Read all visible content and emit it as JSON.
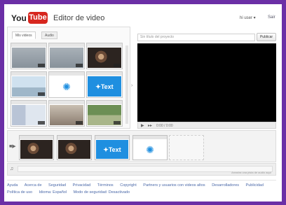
{
  "header": {
    "logo_you": "You",
    "logo_tube": "Tube",
    "title": "Editor de video",
    "user_menu": "hi user ▾",
    "signout": "Sair"
  },
  "library": {
    "tabs": [
      {
        "label": "Mis videos",
        "active": true
      },
      {
        "label": "Audio",
        "active": false
      }
    ],
    "thumbs": [
      {
        "kind": "gray"
      },
      {
        "kind": "gray"
      },
      {
        "kind": "dark"
      },
      {
        "kind": "blue-light"
      },
      {
        "kind": "flower"
      },
      {
        "kind": "text",
        "text": "✦Text"
      },
      {
        "kind": "map"
      },
      {
        "kind": "crowd"
      },
      {
        "kind": "field"
      }
    ]
  },
  "preview": {
    "title_placeholder": "Sin título del proyecto",
    "publish_label": "Publicar",
    "play_icon": "▶",
    "next_icon": "▸▸",
    "time": "0:00 / 0:00"
  },
  "storyboard": {
    "icon": "■▶",
    "clips": [
      {
        "kind": "dark"
      },
      {
        "kind": "dark"
      },
      {
        "kind": "text",
        "text": "✦Text"
      },
      {
        "kind": "flower"
      }
    ]
  },
  "audio": {
    "icon": "♫",
    "hint": "Arrastra una pista de audio aquí"
  },
  "footer": {
    "row1": [
      "Ayuda",
      "Acerca de",
      "Seguridad",
      "Privacidad",
      "Términos",
      "Copyright",
      "Partners y usuarios con videos altos",
      "Desarrolladores",
      "Publicidad"
    ],
    "row2": [
      "Política de uso",
      "Idioma: Español",
      "Modo de seguridad: Desactivado"
    ]
  },
  "colors": {
    "border_purple": "#6b2fa6",
    "youtube_red": "#d7261e",
    "link_blue": "#4a68a8",
    "text_tile_blue": "#1f8fe0"
  }
}
